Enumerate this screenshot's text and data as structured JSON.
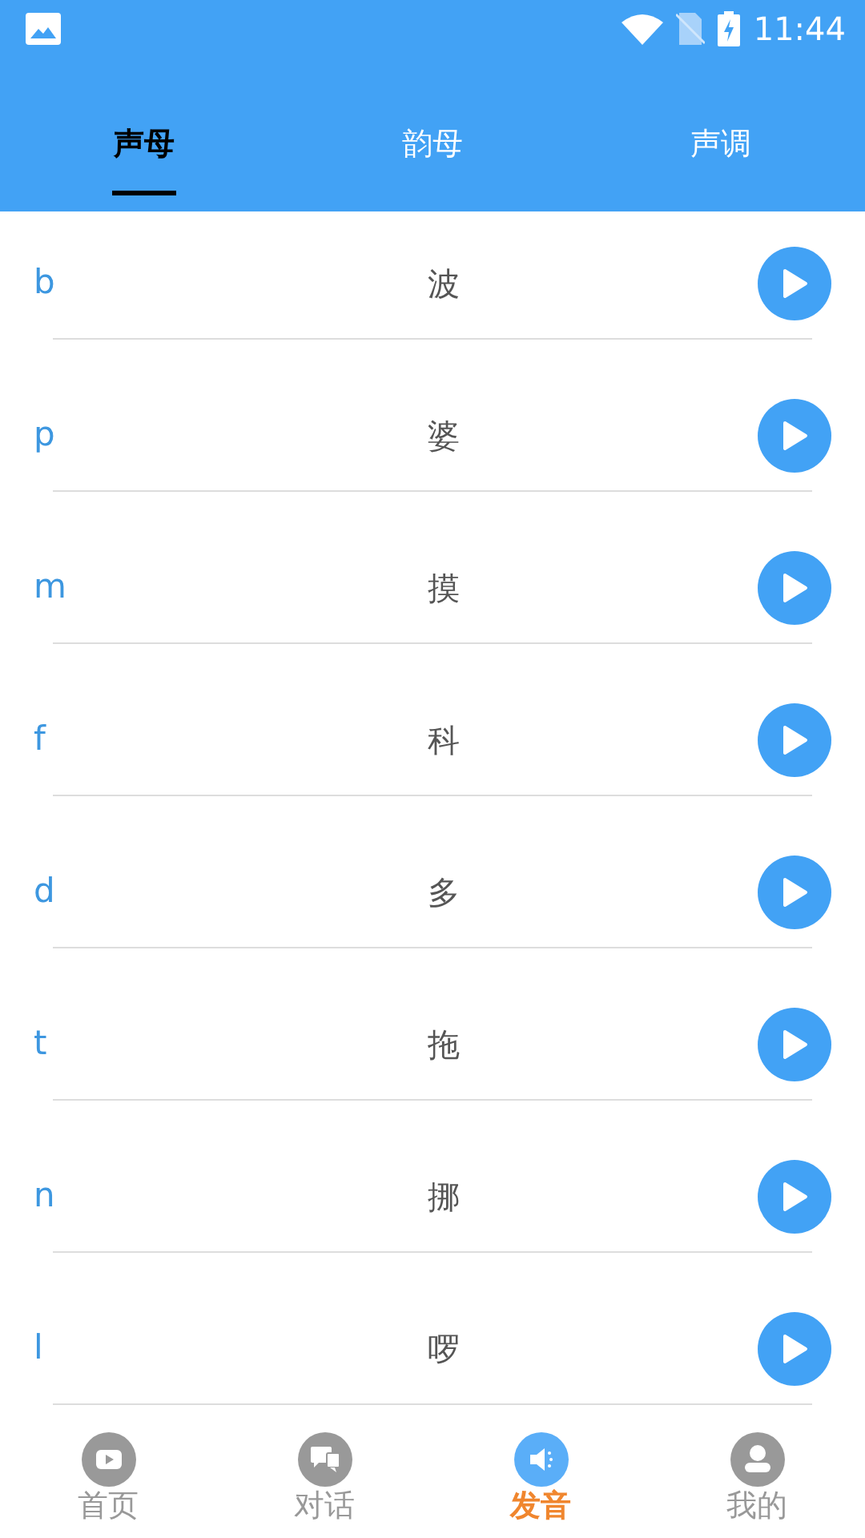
{
  "status_bar": {
    "time": "11:44"
  },
  "tabs": [
    {
      "label": "声母",
      "selected": true
    },
    {
      "label": "韵母",
      "selected": false
    },
    {
      "label": "声调",
      "selected": false
    }
  ],
  "rows": [
    {
      "initial": "b",
      "character": "波"
    },
    {
      "initial": "p",
      "character": "婆"
    },
    {
      "initial": "m",
      "character": "摸"
    },
    {
      "initial": "f",
      "character": "科"
    },
    {
      "initial": "d",
      "character": "多"
    },
    {
      "initial": "t",
      "character": "拖"
    },
    {
      "initial": "n",
      "character": "挪"
    },
    {
      "initial": "l",
      "character": "啰"
    }
  ],
  "bottom_nav": [
    {
      "label": "首页",
      "kind": "home",
      "selected": false
    },
    {
      "label": "对话",
      "kind": "chat",
      "selected": false
    },
    {
      "label": "发音",
      "kind": "sound",
      "selected": true
    },
    {
      "label": "我的",
      "kind": "profile",
      "selected": false
    }
  ]
}
